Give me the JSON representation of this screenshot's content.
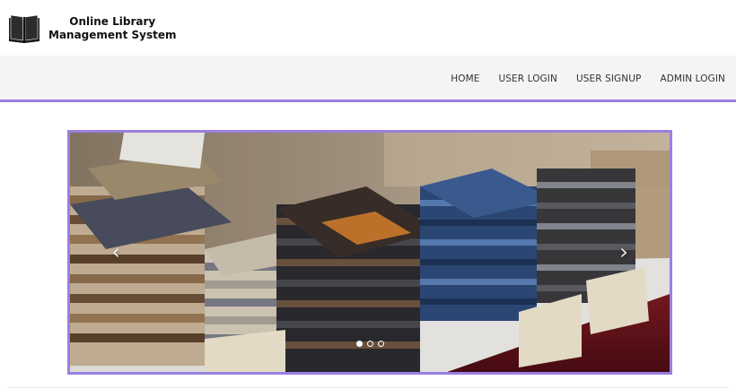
{
  "brand": {
    "logo_icon": "book-icon",
    "title_line1": "Online Library",
    "title_line2": "Management System"
  },
  "nav": {
    "items": [
      {
        "label": "HOME"
      },
      {
        "label": "USER LOGIN"
      },
      {
        "label": "USER SIGNUP"
      },
      {
        "label": "ADMIN LOGIN"
      }
    ]
  },
  "carousel": {
    "image": "stacks-of-books-on-display-table",
    "prev_icon": "chevron-left-icon",
    "next_icon": "chevron-right-icon",
    "prev_glyph": "‹",
    "next_glyph": "›",
    "slide_count": 3,
    "active_slide": 1
  },
  "colors": {
    "accent": "#9b7fe0",
    "navbar_bg": "#f4f4f4"
  }
}
